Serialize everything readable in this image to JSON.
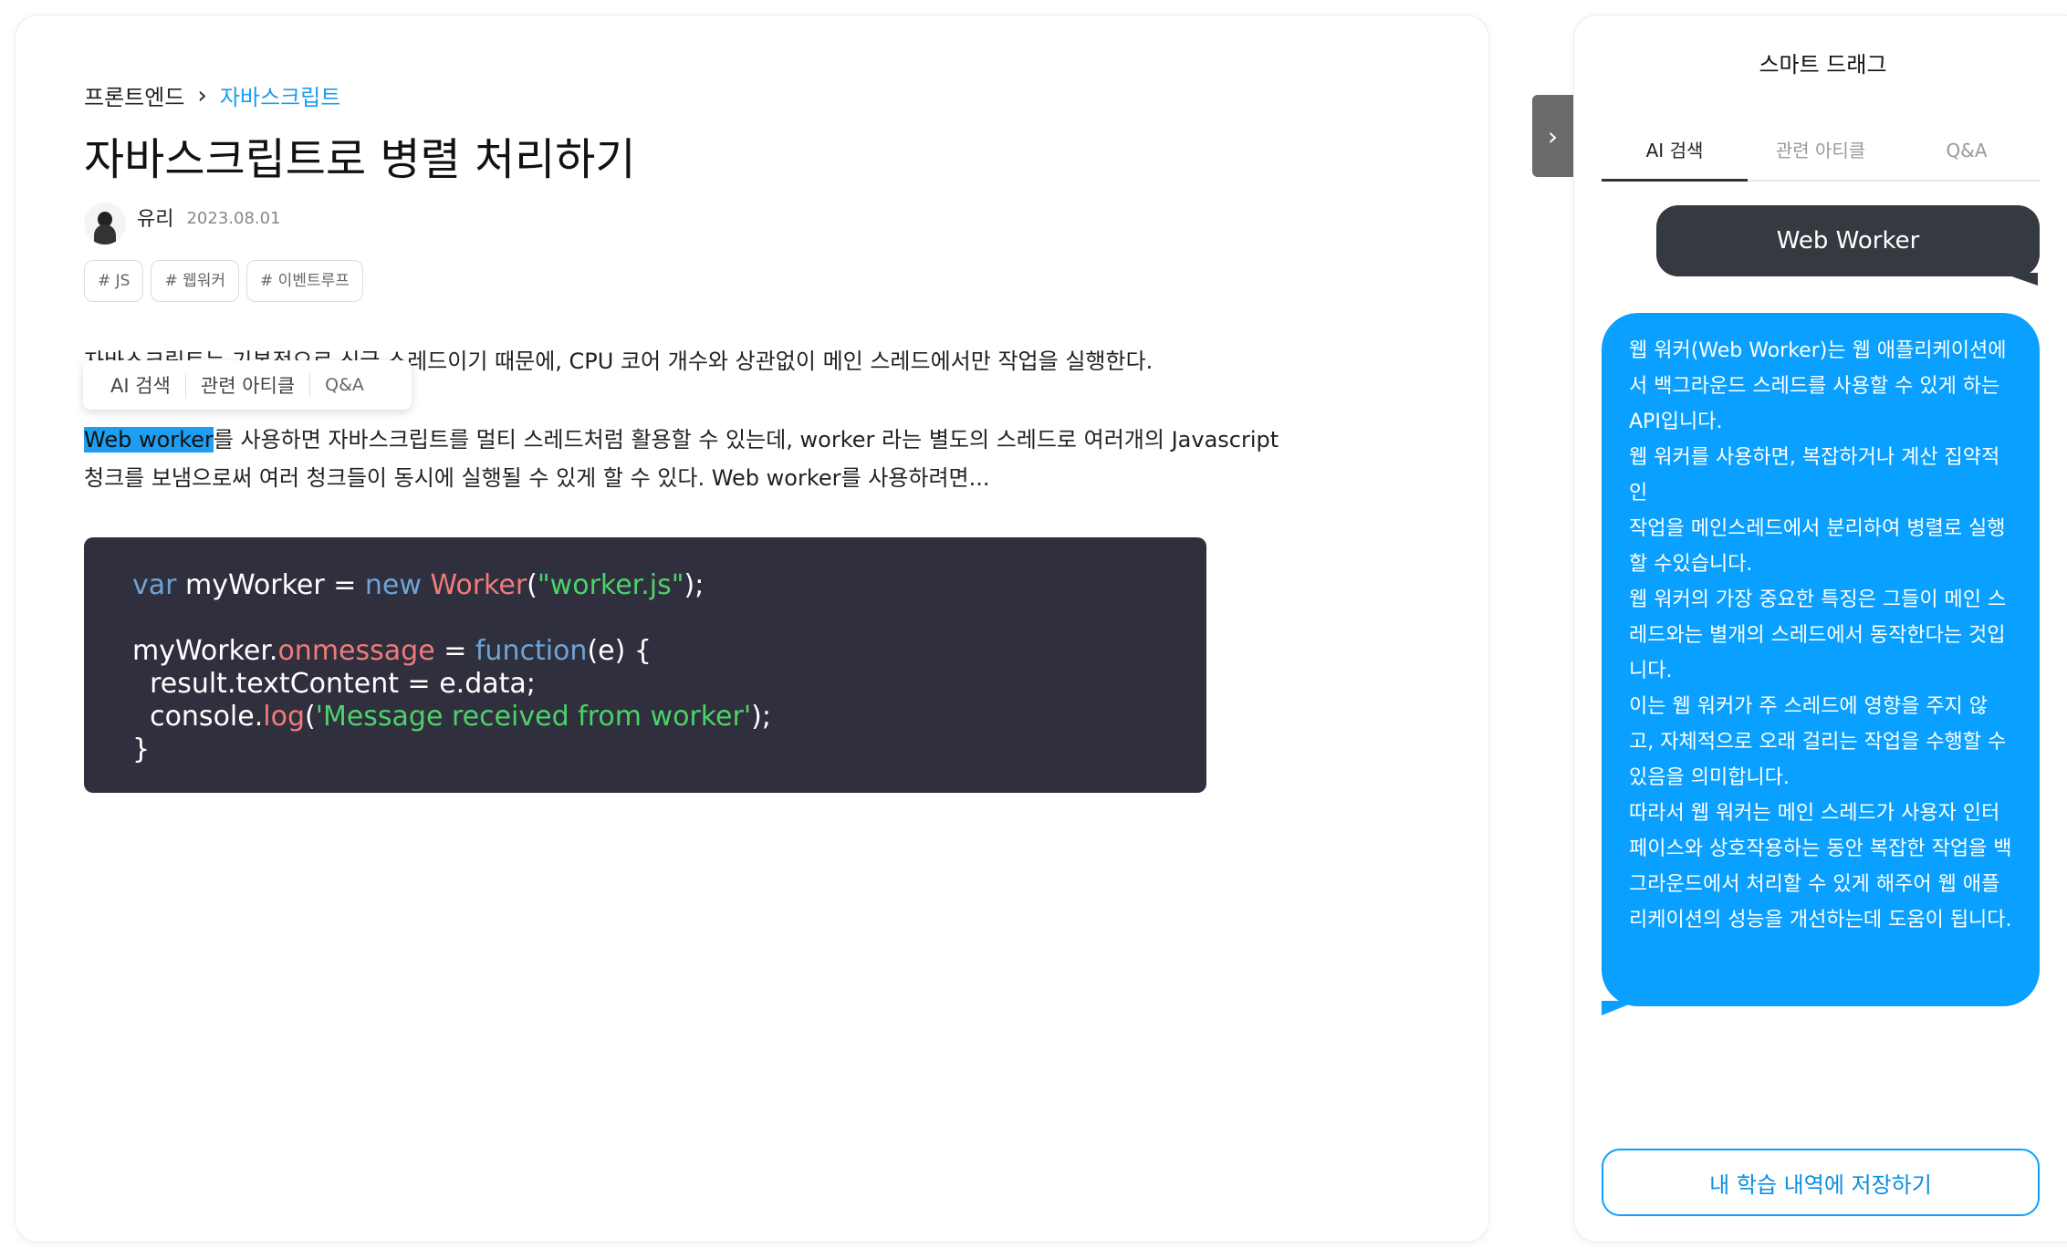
{
  "breadcrumb": {
    "parent": "프론트엔드",
    "current": "자바스크립트"
  },
  "article": {
    "title": "자바스크립트로 병렬 처리하기",
    "author": "유리",
    "date": "2023.08.01",
    "tags": [
      "# JS",
      "# 웹워커",
      "# 이벤트루프"
    ],
    "p1": "자바스크립트는 기본적으로 싱글 스레드이기 때문에, CPU 코어 개수와 상관없이 메인 스레드에서만 작업을 실행한다.",
    "p2_highlight": "Web worker",
    "p2_rest": "를 사용하면 자바스크립트를 멀티 스레드처럼 활용할 수 있는데, worker 라는 별도의 스레드로 여러개의 Javascript 청크를 보냄으로써 여러 청크들이 동시에 실행될 수 있게 할 수 있다. Web worker를 사용하려면..."
  },
  "selection_popup": {
    "ai_search": "AI 검색",
    "related": "관련 아티클",
    "qa": "Q&A"
  },
  "code": {
    "l1_var": "var",
    "l1_name": " myWorker = ",
    "l1_new": "new",
    "l1_cls": " Worker",
    "l1_open": "(",
    "l1_str": "\"worker.js\"",
    "l1_close": ");",
    "l3_obj": "myWorker.",
    "l3_prop": "onmessage",
    "l3_eq": " = ",
    "l3_fn": "function",
    "l3_rest": "(e) {",
    "l4": "  result.textContent = e.data;",
    "l5_obj": "  console.",
    "l5_log": "log",
    "l5_open": "(",
    "l5_str": "'Message received from worker'",
    "l5_close": ");",
    "l6": "}"
  },
  "sidebar": {
    "toggle_icon": "chevron-right-icon",
    "title": "스마트 드래그",
    "tabs": [
      "AI 검색",
      "관련 아티클",
      "Q&A"
    ],
    "question": "Web Worker",
    "answer": [
      "웹 워커(Web Worker)는 웹 애플리케이션에서 백그라운드 스레드를 사용할 수 있게 하는 API입니다.",
      "웹 워커를 사용하면, 복잡하거나 계산 집약적인",
      "작업을 메인스레드에서 분리하여 병렬로 실행할 수있습니다.",
      "웹 워커의 가장 중요한 특징은 그들이 메인 스레드와는 별개의 스레드에서 동작한다는 것입니다.",
      "이는 웹 워커가 주 스레드에 영향을 주지 않고, 자체적으로 오래 걸리는 작업을 수행할 수 있음을 의미합니다.",
      "따라서 웹 워커는 메인 스레드가 사용자 인터페이스와 상호작용하는 동안 복잡한 작업을 백그라운드에서 처리할 수 있게 해주어 웹 애플리케이션의 성능을 개선하는데 도움이 됩니다."
    ],
    "save_label": "내 학습 내역에 저장하기"
  },
  "colors": {
    "accent": "#0aa0ff",
    "code_bg": "#2f2f3d",
    "question_bg": "#343a40"
  }
}
